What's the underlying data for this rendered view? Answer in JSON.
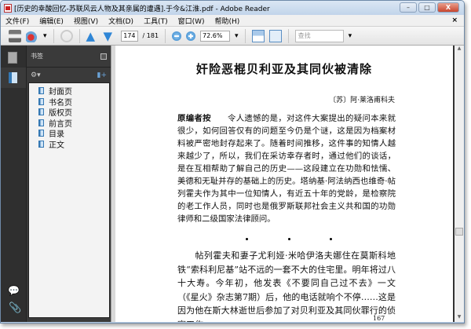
{
  "window": {
    "title": "[历史的幸酸回忆-苏联风云人物及其亲属的遭遇].于今&江淮.pdf - Adobe Reader",
    "minimize": "–",
    "maximize": "□",
    "close": "X"
  },
  "menu": [
    "文件(F)",
    "编辑(E)",
    "视图(V)",
    "文档(D)",
    "工具(T)",
    "窗口(W)",
    "帮助(H)"
  ],
  "menu_close": "×",
  "toolbar": {
    "current_page": "174",
    "total_pages": "/ 181",
    "zoom": "72.6%",
    "find_placeholder": "查找"
  },
  "panel": {
    "title": "书签",
    "bookmarks": [
      "封面页",
      "书名页",
      "版权页",
      "前言页",
      "目录",
      "正文"
    ]
  },
  "document": {
    "title": "奸险恶棍贝利亚及其同伙被清除",
    "author": "〔苏〕阿·莱洛甫科夫",
    "lead": "原编者按",
    "p1": "令人遗憾的是，对这件大案提出的疑问本来就很少，如何回答仅有的问题至今仍是个谜，这是因为档案材料被严密地封存起来了。随着时间推移，这件事的知情人越来越少了，所以，我们在采访幸存者时，通过他们的谈话，是在互相帮助了解自己的历史——这段建立在功勋和怯懦、美德和无耻并存的基础上的历史。塔纳基·阿法纳西也维奇·帖列霍夫作为其中一位知情人，有近五十年的党龄，是检察院的老工作人员，同时也是俄罗斯联邦社会主义共和国的功勋律师和二级国家法律顾问。",
    "p2": "帖列霍夫和妻子尤利娅·米哈伊洛夫娜住在莫斯科地铁“索科利尼基”站不远的一套不大的住宅里。明年将过八十大寿。今年初，他发表《不要同自己过不去》一文（《星火》杂志第7期）后，他的电话就响个不停……这是因为他在斯大林逝世后参加了对贝利亚及其同伙罪行的侦察工作。",
    "page_number": "167"
  }
}
